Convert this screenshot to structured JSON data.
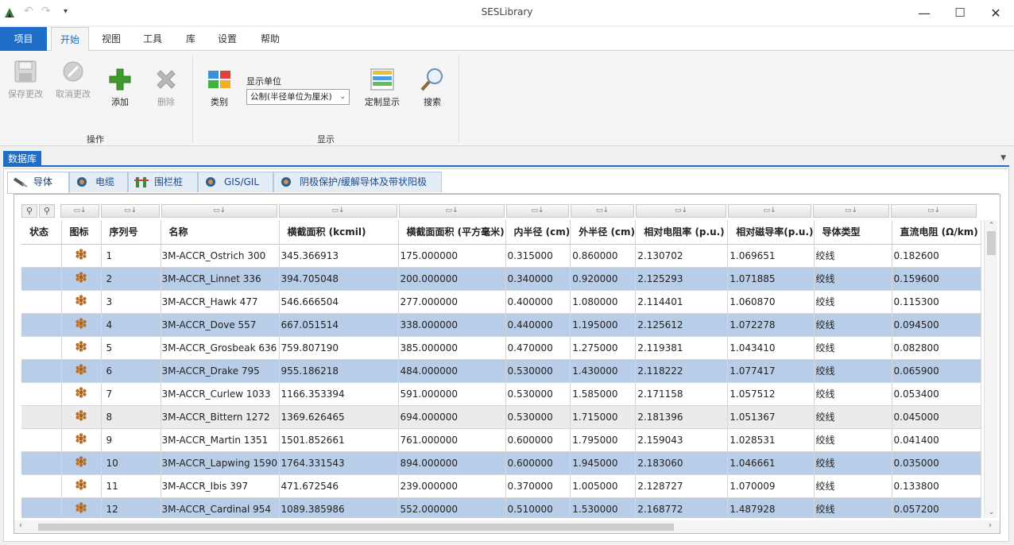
{
  "window": {
    "title": "SESLibrary",
    "minimize": "—",
    "maximize": "☐",
    "close": "✕"
  },
  "ribbon_tabs": [
    "项目",
    "开始",
    "视图",
    "工具",
    "库",
    "设置",
    "帮助"
  ],
  "ribbon": {
    "save": "保存更改",
    "cancel": "取消更改",
    "add": "添加",
    "delete": "删除",
    "group_operations": "操作",
    "category": "类别",
    "display_unit_label": "显示单位",
    "display_unit_value": "公制(半径单位为厘米)",
    "custom_display": "定制显示",
    "search": "搜索",
    "group_display": "显示"
  },
  "panel": {
    "title": "数据库"
  },
  "subtabs": [
    "导体",
    "电缆",
    "围栏桩",
    "GIS/GIL",
    "阴极保护/缓解导体及带状阳极"
  ],
  "table": {
    "columns": [
      "状态",
      "图标",
      "序列号",
      "名称",
      "横截面积 (kcmil)",
      "横截面面积 (平方毫米)",
      "内半径 (cm)",
      "外半径 (cm)",
      "相对电阻率 (p.u.)",
      "相对磁导率(p.u.)",
      "导体类型",
      "直流电阻 (Ω/km)"
    ],
    "rows": [
      [
        "",
        "",
        "1",
        "3M-ACCR_Ostrich 300",
        "345.366913",
        "175.000000",
        "0.315000",
        "0.860000",
        "2.130702",
        "1.069651",
        "绞线",
        "0.182600"
      ],
      [
        "",
        "",
        "2",
        "3M-ACCR_Linnet 336",
        "394.705048",
        "200.000000",
        "0.340000",
        "0.920000",
        "2.125293",
        "1.071885",
        "绞线",
        "0.159600"
      ],
      [
        "",
        "",
        "3",
        "3M-ACCR_Hawk 477",
        "546.666504",
        "277.000000",
        "0.400000",
        "1.080000",
        "2.114401",
        "1.060870",
        "绞线",
        "0.115300"
      ],
      [
        "",
        "",
        "4",
        "3M-ACCR_Dove 557",
        "667.051514",
        "338.000000",
        "0.440000",
        "1.195000",
        "2.125612",
        "1.072278",
        "绞线",
        "0.094500"
      ],
      [
        "",
        "",
        "5",
        "3M-ACCR_Grosbeak 636",
        "759.807190",
        "385.000000",
        "0.470000",
        "1.275000",
        "2.119381",
        "1.043410",
        "绞线",
        "0.082800"
      ],
      [
        "",
        "",
        "6",
        "3M-ACCR_Drake 795",
        "955.186218",
        "484.000000",
        "0.530000",
        "1.430000",
        "2.118222",
        "1.077417",
        "绞线",
        "0.065900"
      ],
      [
        "",
        "",
        "7",
        "3M-ACCR_Curlew 1033",
        "1166.353394",
        "591.000000",
        "0.530000",
        "1.585000",
        "2.171158",
        "1.057512",
        "绞线",
        "0.053400"
      ],
      [
        "",
        "",
        "8",
        "3M-ACCR_Bittern 1272",
        "1369.626465",
        "694.000000",
        "0.530000",
        "1.715000",
        "2.181396",
        "1.051367",
        "绞线",
        "0.045000"
      ],
      [
        "",
        "",
        "9",
        "3M-ACCR_Martin 1351",
        "1501.852661",
        "761.000000",
        "0.600000",
        "1.795000",
        "2.159043",
        "1.028531",
        "绞线",
        "0.041400"
      ],
      [
        "",
        "",
        "10",
        "3M-ACCR_Lapwing 1590",
        "1764.331543",
        "894.000000",
        "0.600000",
        "1.945000",
        "2.183060",
        "1.046661",
        "绞线",
        "0.035000"
      ],
      [
        "",
        "",
        "11",
        "3M-ACCR_Ibis 397",
        "471.672546",
        "239.000000",
        "0.370000",
        "1.005000",
        "2.128727",
        "1.070009",
        "绞线",
        "0.133800"
      ],
      [
        "",
        "",
        "12",
        "3M-ACCR_Cardinal 954",
        "1089.385986",
        "552.000000",
        "0.510000",
        "1.530000",
        "2.168772",
        "1.487928",
        "绞线",
        "0.057200"
      ]
    ]
  },
  "colors": {
    "accent": "#1e6ec8",
    "row_alt": "#b7cde8",
    "row_selected": "#ebebeb"
  }
}
